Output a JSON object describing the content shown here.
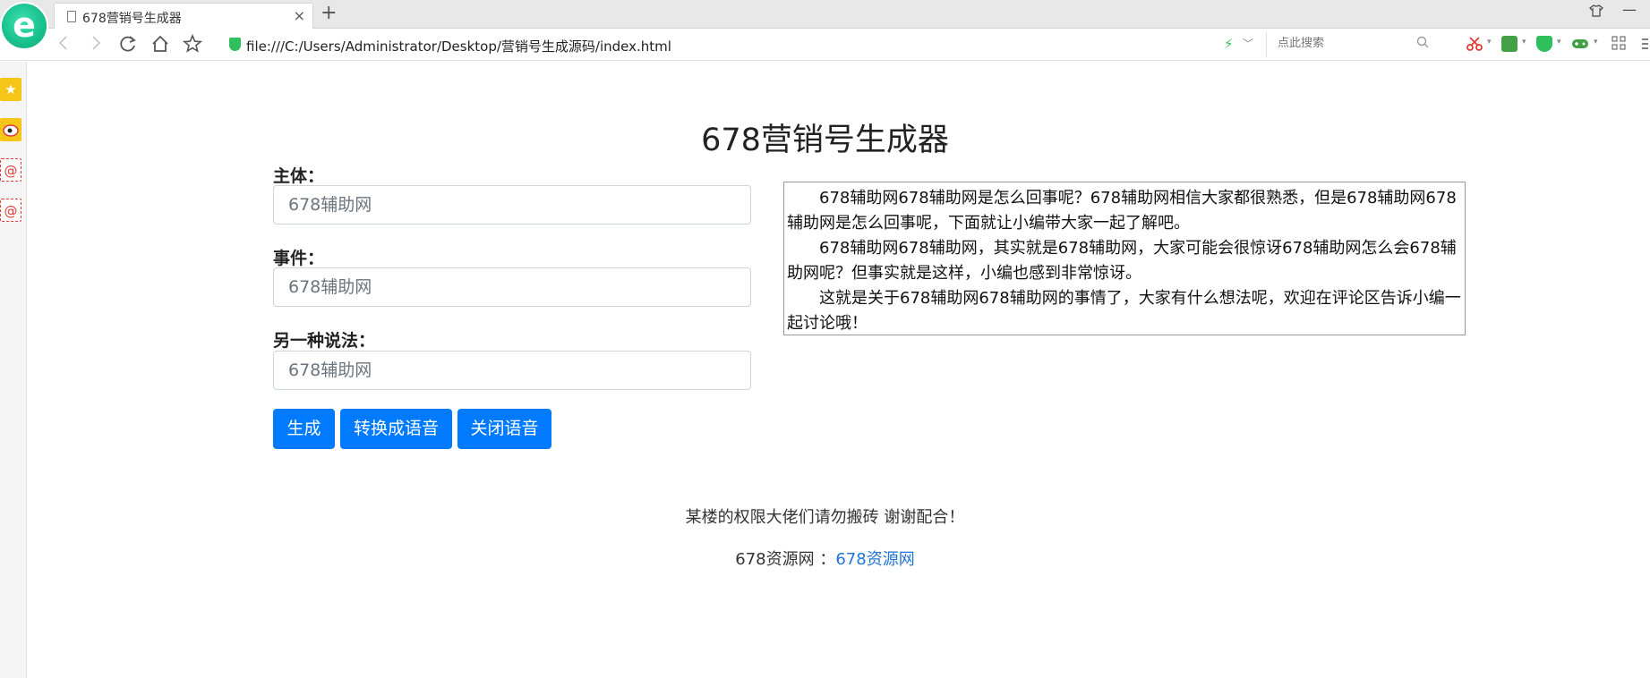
{
  "browser": {
    "tab_title": "678营销号生成器",
    "tab_close": "×",
    "new_tab": "+",
    "url": "file:///C:/Users/Administrator/Desktop/营销号生成源码/index.html",
    "search_placeholder": "点此搜索",
    "icons": {
      "back": "chevron-left-icon",
      "forward": "chevron-right-icon",
      "refresh": "refresh-icon",
      "home": "home-icon",
      "favorite": "star-icon",
      "security": "shield-icon",
      "speed": "lightning-icon",
      "search": "search-icon"
    },
    "extension_colors": [
      "#e53935",
      "#43a047",
      "#2fbf5c",
      "#43a047",
      "#555555"
    ]
  },
  "sidebar": {
    "items": [
      {
        "icon": "star-icon",
        "glyph": "★",
        "color": "#f5b800"
      },
      {
        "icon": "weibo-icon",
        "glyph": "◉",
        "color": "#e53935"
      },
      {
        "icon": "mail-icon",
        "glyph": "@",
        "color": "#e53935"
      },
      {
        "icon": "mail-icon",
        "glyph": "@",
        "color": "#e53935"
      }
    ]
  },
  "page": {
    "title": "678营销号生成器",
    "form": {
      "subject_label": "主体：",
      "subject_placeholder": "678辅助网",
      "event_label": "事件：",
      "event_placeholder": "678辅助网",
      "alt_label": "另一种说法：",
      "alt_placeholder": "678辅助网"
    },
    "buttons": {
      "generate": "生成",
      "to_speech": "转换成语音",
      "stop_speech": "关闭语音"
    },
    "output": {
      "paragraphs": [
        "678辅助网678辅助网是怎么回事呢？678辅助网相信大家都很熟悉，但是678辅助网678辅助网是怎么回事呢，下面就让小编带大家一起了解吧。",
        "678辅助网678辅助网，其实就是678辅助网，大家可能会很惊讶678辅助网怎么会678辅助网呢？但事实就是这样，小编也感到非常惊讶。",
        "这就是关于678辅助网678辅助网的事情了，大家有什么想法呢，欢迎在评论区告诉小编一起讨论哦！"
      ]
    },
    "footer": {
      "note": "某楼的权限大佬们请勿搬砖 谢谢配合！",
      "site_label": "678资源网 ：",
      "site_link": "678资源网"
    },
    "colors": {
      "primary": "#007bff",
      "link": "#1f74d6"
    }
  }
}
